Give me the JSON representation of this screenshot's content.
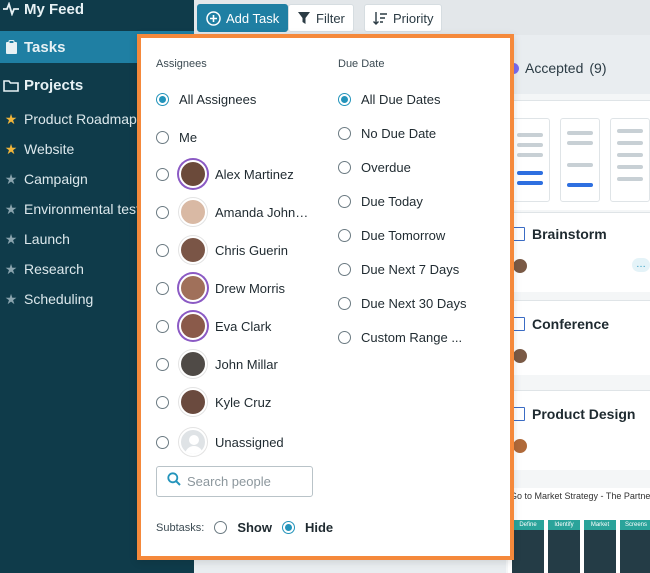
{
  "sidebar": {
    "my_feed": "My Feed",
    "tasks": "Tasks",
    "projects": "Projects",
    "project_items": [
      {
        "label": "Product Roadmap",
        "starred": true
      },
      {
        "label": "Website",
        "starred": true
      },
      {
        "label": "Campaign",
        "starred": false
      },
      {
        "label": "Environmental testing",
        "starred": false
      },
      {
        "label": "Launch",
        "starred": false
      },
      {
        "label": "Research",
        "starred": false
      },
      {
        "label": "Scheduling",
        "starred": false
      }
    ]
  },
  "toolbar": {
    "add_task": "Add Task",
    "filter": "Filter",
    "priority": "Priority"
  },
  "board": {
    "column_title": "Accepted",
    "column_count": "(9)",
    "tasks": [
      "Brainstorm",
      "Conference",
      "Product Design"
    ],
    "strategy_title": "Go to Market Strategy - The Partner P",
    "strategy_heads": [
      "Define",
      "Identify",
      "Market",
      "Screens"
    ]
  },
  "filter_popup": {
    "assignees_title": "Assignees",
    "due_date_title": "Due Date",
    "assignees": [
      {
        "label": "All Assignees",
        "selected": true
      },
      {
        "label": "Me",
        "selected": false
      },
      {
        "label": "Alex Martinez",
        "selected": false
      },
      {
        "label": "Amanda John…",
        "selected": false
      },
      {
        "label": "Chris Guerin",
        "selected": false
      },
      {
        "label": "Drew Morris",
        "selected": false
      },
      {
        "label": "Eva Clark",
        "selected": false
      },
      {
        "label": "John Millar",
        "selected": false
      },
      {
        "label": "Kyle Cruz",
        "selected": false
      },
      {
        "label": "Unassigned",
        "selected": false
      }
    ],
    "due_dates": [
      {
        "label": "All Due Dates",
        "selected": true
      },
      {
        "label": "No Due Date",
        "selected": false
      },
      {
        "label": "Overdue",
        "selected": false
      },
      {
        "label": "Due Today",
        "selected": false
      },
      {
        "label": "Due Tomorrow",
        "selected": false
      },
      {
        "label": "Due Next 7 Days",
        "selected": false
      },
      {
        "label": "Due Next 30 Days",
        "selected": false
      },
      {
        "label": "Custom Range ...",
        "selected": false
      }
    ],
    "search_placeholder": "Search people",
    "subtasks_label": "Subtasks:",
    "subtasks_show": "Show",
    "subtasks_hide": "Hide",
    "subtasks_selected": "Hide"
  },
  "colors": {
    "sidebar_bg": "#0f3b4a",
    "sidebar_active": "#1f7fa3",
    "popup_border": "#f5893b",
    "radio_accent": "#2394bb",
    "accepted_dot": "#7b6cf0"
  }
}
